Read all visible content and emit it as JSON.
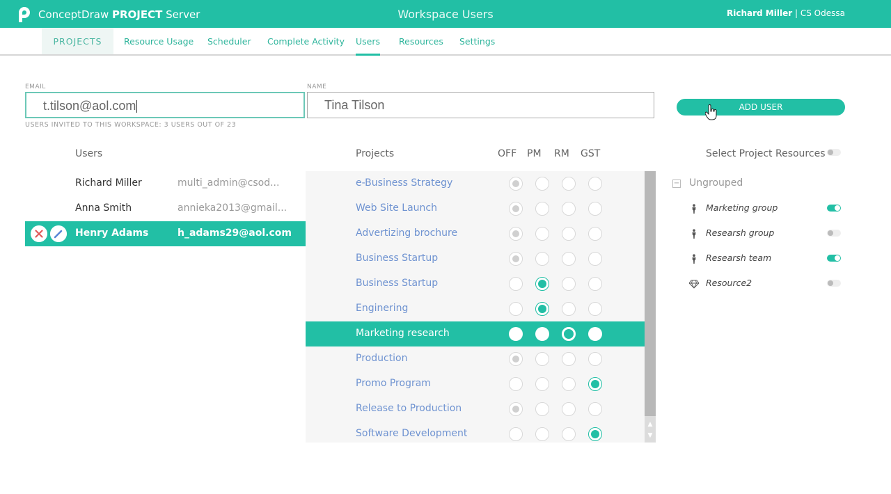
{
  "header": {
    "app_name_prefix": "ConceptDraw",
    "app_name_bold": "PROJECT",
    "app_name_suffix": "Server",
    "page_title": "Workspace Users",
    "user_name": "Richard Miller",
    "separator": "|",
    "organization": "CS Odessa"
  },
  "nav": {
    "items": [
      {
        "label": "PROJECTS"
      },
      {
        "label": "Resource Usage"
      },
      {
        "label": "Scheduler"
      },
      {
        "label": "Complete Activity"
      },
      {
        "label": "Users",
        "active": true
      },
      {
        "label": "Resources"
      },
      {
        "label": "Settings"
      }
    ]
  },
  "form": {
    "email_label": "EMAIL",
    "email_value": "t.tilson@aol.com",
    "name_label": "NAME",
    "name_value": "Tina Tilson",
    "invite_info": "USERS INVITED TO THIS WORKSPACE: 3 USERS OUT OF 23",
    "add_button": "ADD USER"
  },
  "users": {
    "header": "Users",
    "rows": [
      {
        "name": "Richard Miller",
        "email": "multi_admin@csod..."
      },
      {
        "name": "Anna Smith",
        "email": "annieka2013@gmail..."
      },
      {
        "name": "Henry Adams",
        "email": "h_adams29@aol.com",
        "selected": true
      }
    ]
  },
  "projects": {
    "header": "Projects",
    "role_headers": [
      "OFF",
      "PM",
      "RM",
      "GST"
    ],
    "rows": [
      {
        "name": "e-Business Strategy",
        "role": "OFF",
        "role_disabled": true
      },
      {
        "name": "Web Site Launch",
        "role": "OFF",
        "role_disabled": true
      },
      {
        "name": "Advertizing brochure",
        "role": "OFF",
        "role_disabled": true
      },
      {
        "name": "Business Startup",
        "role": "OFF",
        "role_disabled": true
      },
      {
        "name": "Business Startup",
        "role": "PM"
      },
      {
        "name": "Enginering",
        "role": "PM"
      },
      {
        "name": "Marketing research",
        "role": "RM",
        "selected": true
      },
      {
        "name": "Production",
        "role": "OFF",
        "role_disabled": true
      },
      {
        "name": "Promo Program",
        "role": "GST"
      },
      {
        "name": "Release to Production",
        "role": "OFF",
        "role_disabled": true
      },
      {
        "name": "Software Development",
        "role": "GST"
      }
    ]
  },
  "resources": {
    "header": "Select Project Resources",
    "select_all_on": false,
    "group_label": "Ungrouped",
    "collapse_symbol": "−",
    "items": [
      {
        "name": "Marketing group",
        "icon": "person-icon",
        "enabled": true
      },
      {
        "name": "Researsh group",
        "icon": "person-icon",
        "enabled": false
      },
      {
        "name": "Researsh team",
        "icon": "person-icon",
        "enabled": true
      },
      {
        "name": "Resource2",
        "icon": "diamond-icon",
        "enabled": false
      }
    ]
  },
  "scroll": {
    "up": "▲",
    "down": "▼"
  },
  "colors": {
    "accent": "#22bfa5",
    "link": "#6f93d1"
  }
}
